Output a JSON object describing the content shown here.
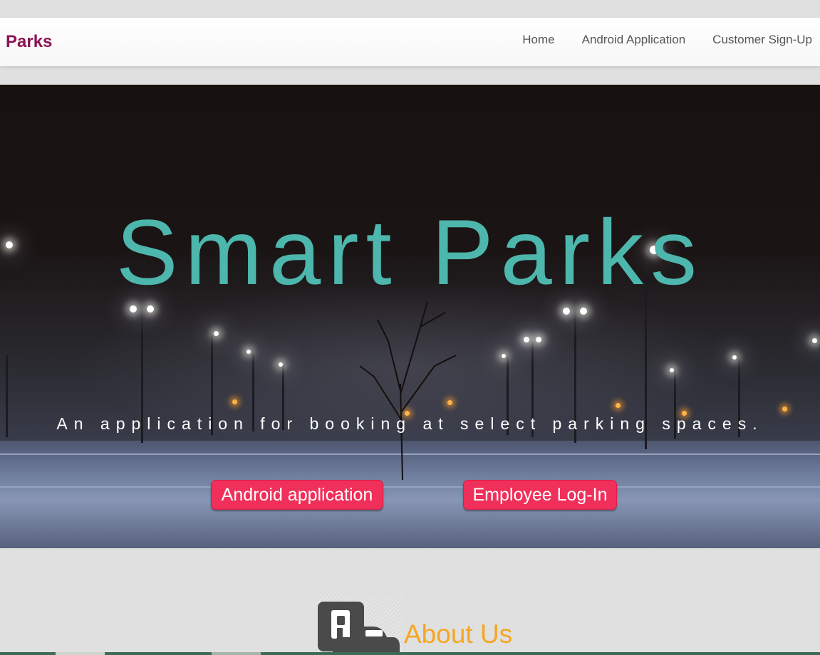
{
  "navbar": {
    "brand": "Parks",
    "links": [
      "Home",
      "Android Application",
      "Customer Sign-Up"
    ]
  },
  "hero": {
    "title": "Smart Parks",
    "tagline": "An application for booking at select parking spaces.",
    "buttons": {
      "android": "Android application",
      "employee": "Employee Log-In"
    }
  },
  "about": {
    "title": "About Us",
    "icon": "parking-car-icon"
  },
  "colors": {
    "brand": "#8b1452",
    "title_teal": "#4db6ad",
    "button_red": "#f0305a",
    "about_orange": "#f5a623"
  }
}
